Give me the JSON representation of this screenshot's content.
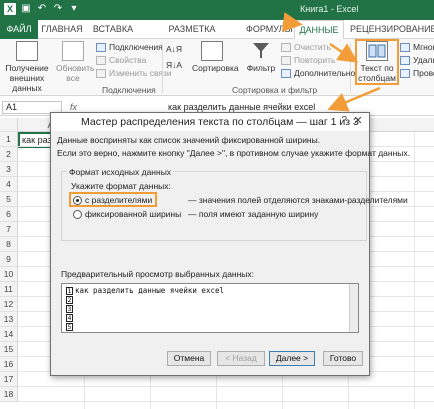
{
  "window": {
    "title": "Книга1 - Excel"
  },
  "ribbon_tabs": [
    {
      "label": "ФАЙЛ"
    },
    {
      "label": "ГЛАВНАЯ"
    },
    {
      "label": "ВСТАВКА"
    },
    {
      "label": "РАЗМЕТКА СТРАНИЦЫ"
    },
    {
      "label": "ФОРМУЛЫ"
    },
    {
      "label": "ДАННЫЕ"
    },
    {
      "label": "РЕЦЕНЗИРОВАНИЕ"
    }
  ],
  "ribbon": {
    "get_external": "Получение внешних данных",
    "refresh_all": "Обновить все",
    "connections": "Подключения",
    "properties": "Свойства",
    "edit_links": "Изменить связи",
    "connections_group": "Подключения",
    "sort_asc": "А↓Я",
    "sort_desc": "Я↓А",
    "sort": "Сортировка",
    "filter": "Фильтр",
    "clear": "Очистить",
    "reapply": "Повторить",
    "advanced": "Дополнительно",
    "sort_filter_group": "Сортировка и фильтр",
    "text_to_columns": "Текст по столбцам",
    "flash_fill": "Мгнове",
    "remove_dup": "Удалит",
    "validate": "Провер"
  },
  "formula_bar": {
    "name_box": "A1",
    "fx": "fx",
    "value": "как разделить данные ячейки excel"
  },
  "grid": {
    "columns": [
      "A"
    ],
    "rows": [
      "1",
      "2",
      "3",
      "4",
      "5",
      "6",
      "7",
      "8",
      "9",
      "10",
      "11",
      "12",
      "13",
      "14",
      "15",
      "16",
      "17",
      "18"
    ],
    "a1": "как раз"
  },
  "dialog": {
    "title": "Мастер распределения текста по столбцам — шаг 1 из 3",
    "help": "?",
    "close": "✕",
    "line1": "Данные восприняты как список значений фиксированной ширины.",
    "line2": "Если это верно, нажмите кнопку \"Далее >\", в противном случае укажите формат данных.",
    "source_format": "Формат исходных данных",
    "specify_format": "Укажите формат данных:",
    "opt_delimited": "с разделителями",
    "opt_delimited_desc": "— значения полей отделяются знаками-разделителями",
    "opt_fixed": "фиксированной ширины",
    "opt_fixed_desc": "— поля имеют заданную ширину",
    "preview_label": "Предварительный просмотр выбранных данных:",
    "preview_rows": [
      {
        "n": "1",
        "text": "как разделить данные ячейки excel"
      },
      {
        "n": "2",
        "text": ""
      },
      {
        "n": "3",
        "text": ""
      },
      {
        "n": "4",
        "text": ""
      },
      {
        "n": "5",
        "text": ""
      }
    ],
    "btn_cancel": "Отмена",
    "btn_back": "< Назад",
    "btn_next": "Далее >",
    "btn_finish": "Готово"
  },
  "colors": {
    "excel_green": "#217346",
    "highlight_orange": "#f29d38"
  }
}
